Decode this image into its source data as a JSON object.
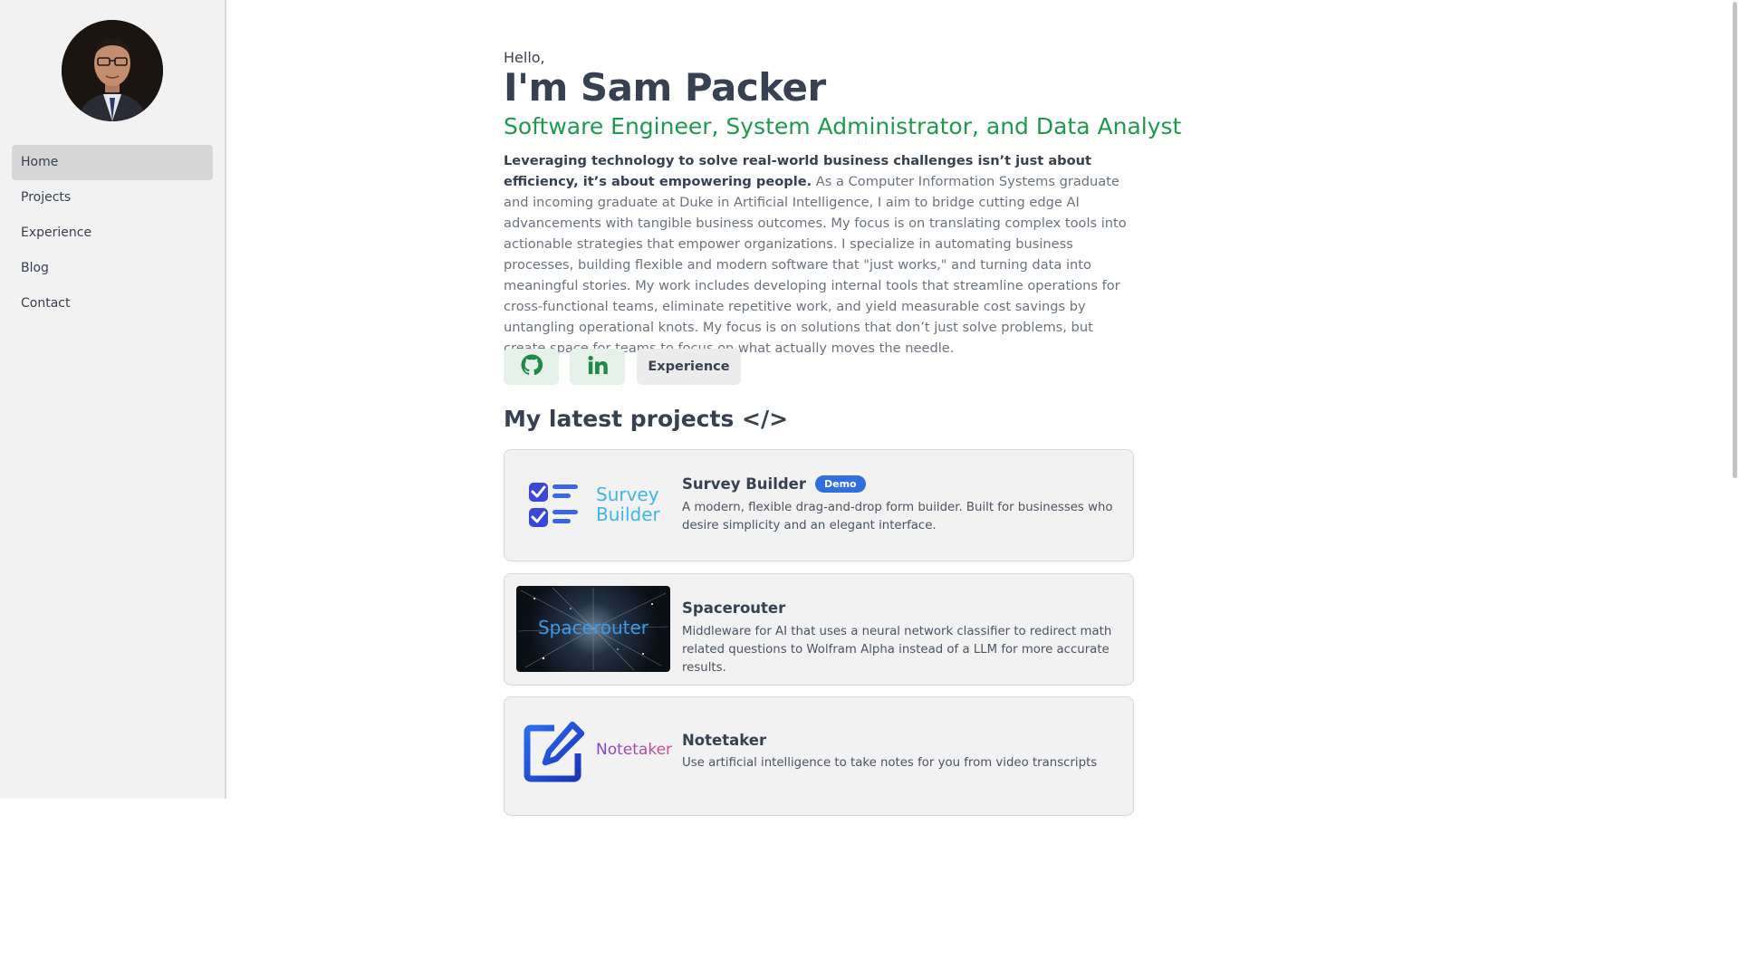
{
  "sidebar": {
    "nav": [
      {
        "label": "Home",
        "active": true
      },
      {
        "label": "Projects",
        "active": false
      },
      {
        "label": "Experience",
        "active": false
      },
      {
        "label": "Blog",
        "active": false
      },
      {
        "label": "Contact",
        "active": false
      }
    ]
  },
  "hero": {
    "greeting": "Hello,",
    "name": "I'm Sam Packer",
    "roles": "Software Engineer, System Administrator, and Data Analyst",
    "bio_lead": "Leveraging technology to solve real-world business challenges isn’t just about efficiency, it’s about empowering people.",
    "bio_rest": " As a Computer Information Systems graduate and incoming graduate at Duke in Artificial Intelligence, I aim to bridge cutting edge AI advancements with tangible business outcomes. My focus is on translating complex tools into actionable strategies that empower organizations. I specialize in automating business processes, building flexible and modern software that \"just works,\" and turning data into meaningful stories. My work includes developing internal tools that streamline operations for cross-functional teams, eliminate repetitive work, and yield measurable cost savings by untangling operational knots. My focus is on solutions that don’t just solve problems, but create space for teams to focus on what actually moves the needle.",
    "experience_button": "Experience",
    "accent_color": "#1f9a4c"
  },
  "projects": {
    "heading": "My latest projects </>",
    "items": [
      {
        "title": "Survey Builder",
        "badge": "Demo",
        "logo_line1": "Survey",
        "logo_line2": "Builder",
        "description": "A modern, flexible drag-and-drop form builder. Built for businesses who desire simplicity and an elegant interface."
      },
      {
        "title": "Spacerouter",
        "logo_text": "Spacerouter",
        "description": "Middleware for AI that uses a neural network classifier to redirect math related questions to Wolfram Alpha instead of a LLM for more accurate results."
      },
      {
        "title": "Notetaker",
        "logo_text": "Notetaker",
        "description": "Use artificial intelligence to take notes for you from video transcripts"
      }
    ]
  },
  "icons": {
    "github": "github-icon",
    "linkedin": "linkedin-icon"
  }
}
